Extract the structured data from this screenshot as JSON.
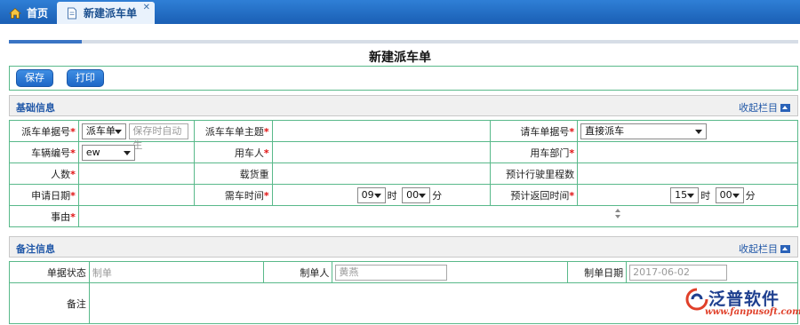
{
  "tabs": [
    {
      "label": "首页",
      "icon": "home-icon"
    },
    {
      "label": "新建派车单",
      "icon": "document-icon",
      "close": "✕"
    }
  ],
  "page_title": "新建派车单",
  "toolbar": {
    "save_label": "保存",
    "print_label": "打印"
  },
  "basic_section": {
    "title": "基础信息",
    "collapse_label": "收起栏目",
    "fields": {
      "dispatch_no_label": "派车单据号",
      "dispatch_no_type": "派车单",
      "dispatch_no_placeholder": "保存时自动生",
      "subject_label": "派车车单主题",
      "request_no_label": "请车单据号",
      "request_no_value": "直接派车",
      "vehicle_no_label": "车辆编号",
      "vehicle_no_value": "ew",
      "user_label": "用车人",
      "department_label": "用车部门",
      "people_label": "人数",
      "load_label": "载货重",
      "mileage_label": "预计行驶里程数",
      "apply_date_label": "申请日期",
      "need_time_label": "需车时间",
      "need_hour": "09",
      "need_minute": "00",
      "return_time_label": "预计返回时间",
      "return_hour": "15",
      "return_minute": "00",
      "hour_unit": "时",
      "minute_unit": "分",
      "reason_label": "事由",
      "required_mark": "*"
    }
  },
  "remark_section": {
    "title": "备注信息",
    "collapse_label": "收起栏目",
    "status_label": "单据状态",
    "status_value": "制单",
    "creator_label": "制单人",
    "creator_value": "黄燕",
    "create_date_label": "制单日期",
    "create_date_value": "2017-06-02",
    "remark_label": "备注"
  },
  "logo": {
    "name": "泛普软件",
    "url": "www.fanpusoft.com"
  },
  "colors": {
    "accent": "#1a5fb4",
    "border": "#59b98a",
    "required": "#e01010",
    "section_title": "#2158a8"
  }
}
